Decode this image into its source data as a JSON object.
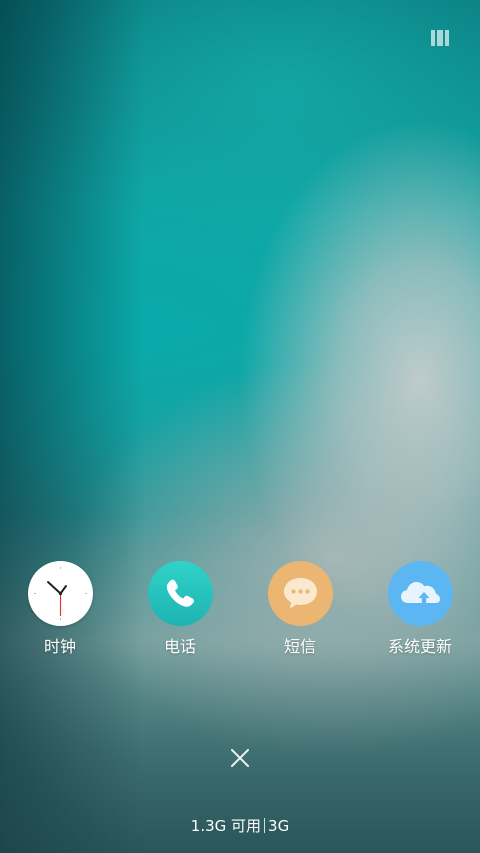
{
  "apps": [
    {
      "label": "时钟",
      "icon": "clock-icon"
    },
    {
      "label": "电话",
      "icon": "phone-icon"
    },
    {
      "label": "短信",
      "icon": "message-bubble-icon"
    },
    {
      "label": "系统更新",
      "icon": "cloud-upload-icon"
    }
  ],
  "memory": {
    "available": "1.3G 可用",
    "total": "3G"
  },
  "colors": {
    "phone": "#25c4bf",
    "sms": "#eab672",
    "update": "#5cb6f2",
    "clock_face": "#ffffff"
  }
}
